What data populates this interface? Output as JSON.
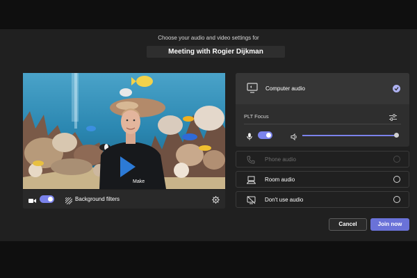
{
  "header": {
    "subtitle": "Choose your audio and video settings for",
    "meeting_title": "Meeting with Rogier Dijkman"
  },
  "video": {
    "camera_on": true,
    "background_filters_label": "Background filters",
    "shirt_text": "Make"
  },
  "audio": {
    "selected": "Computer audio",
    "computer_audio_label": "Computer audio",
    "device_name": "PLT Focus",
    "mic_on": true,
    "volume_level": 1.0,
    "phone_audio_label": "Phone audio",
    "room_audio_label": "Room audio",
    "dont_use_audio_label": "Don't use audio"
  },
  "actions": {
    "cancel_label": "Cancel",
    "join_label": "Join now"
  },
  "colors": {
    "accent": "#7b83eb",
    "join_button": "#6a72d8",
    "dialog_bg": "#202020",
    "card_bg": "#2e2e2e"
  },
  "icons": {
    "camera": "video-camera-icon",
    "background_filters": "background-filters-icon",
    "settings": "gear-icon",
    "computer_audio": "monitor-speaker-icon",
    "device_settings": "sliders-icon",
    "microphone": "microphone-icon",
    "speaker": "speaker-icon",
    "phone_audio": "phone-icon",
    "room_audio": "room-display-icon",
    "no_audio": "no-audio-icon",
    "selected": "checkmark-icon"
  }
}
